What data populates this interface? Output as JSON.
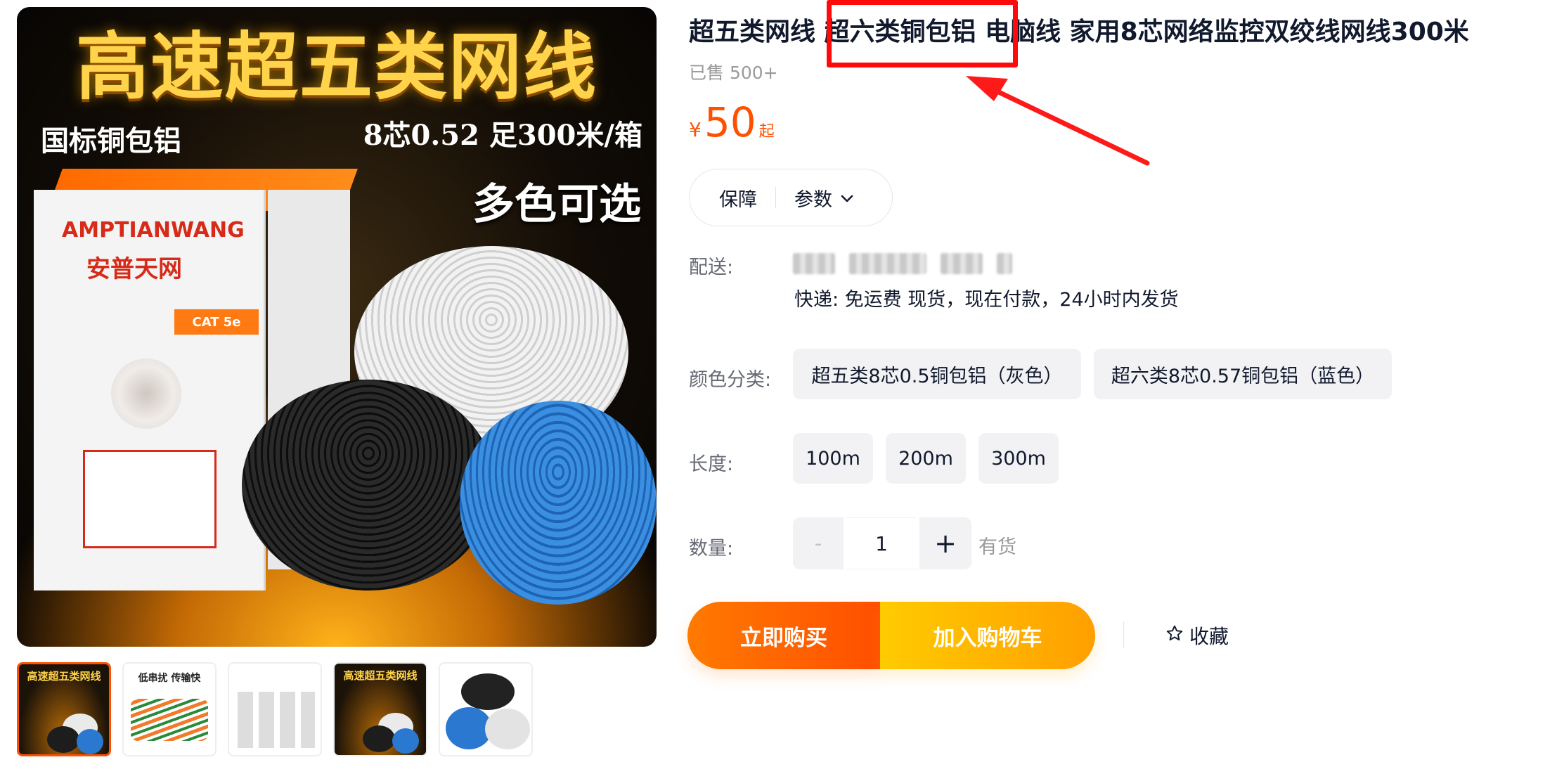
{
  "gallery": {
    "main_image": {
      "banner_title": "高速超五类网线",
      "tag_left": "国标铜包铝",
      "tag_right": "8芯0.52 足300米/箱",
      "multi_color": "多色可选",
      "brand": "AMPTIANWANG",
      "brand_cn": "安普天网",
      "badge": "CAT 5e"
    },
    "thumbnails": [
      {
        "title": "高速超五类网线",
        "active": true
      },
      {
        "title": "低串扰 传输快"
      },
      {
        "title": ""
      },
      {
        "title": "高速超五类网线"
      },
      {
        "title": ""
      }
    ]
  },
  "product": {
    "title": "超五类网线 超六类铜包铝 电脑线 家用8芯网络监控双绞线网线300米",
    "highlighted_text": "超六类铜包铝",
    "sold": "已售 500+",
    "price": {
      "symbol": "¥",
      "value": "50",
      "suffix": "起"
    },
    "guarantee_label": "保障",
    "params_label": "参数",
    "shipping_label": "配送:",
    "shipping_info": "快递: 免运费  现货，现在付款，24小时内发货",
    "color_label": "颜色分类:",
    "color_options": [
      "超五类8芯0.5铜包铝（灰色）",
      "超六类8芯0.57铜包铝（蓝色）"
    ],
    "length_label": "长度:",
    "length_options": [
      "100m",
      "200m",
      "300m"
    ],
    "quantity_label": "数量:",
    "quantity_minus": "-",
    "quantity_value": "1",
    "quantity_plus": "+",
    "stock": "有货",
    "buy_now": "立即购买",
    "add_to_cart": "加入购物车",
    "favorite": "收藏"
  },
  "colors": {
    "accent": "#ff5000",
    "annotation_red": "#ff0a0a"
  }
}
